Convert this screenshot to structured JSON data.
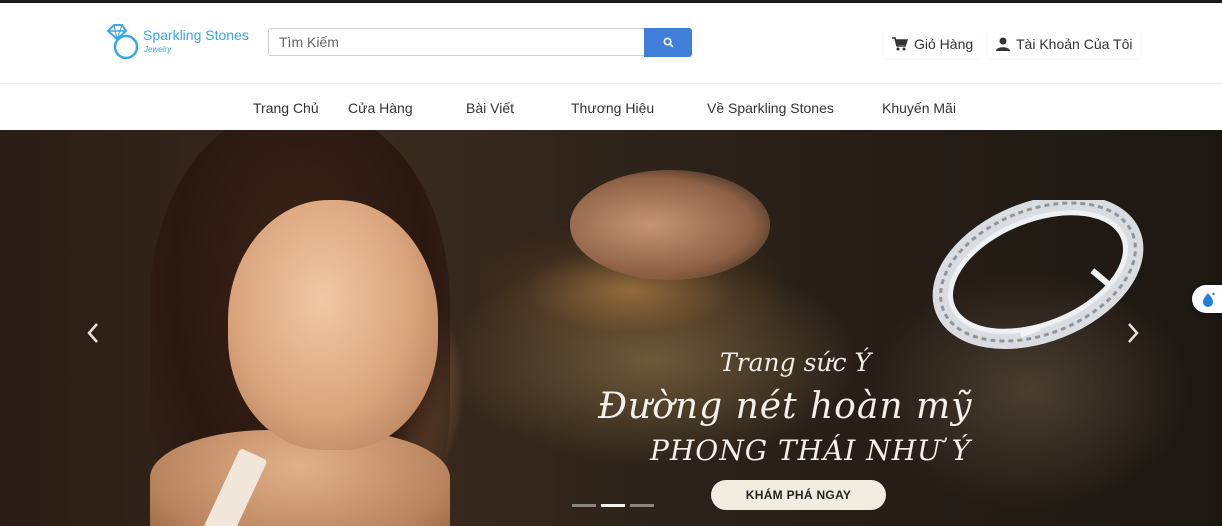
{
  "brand": {
    "name": "Sparkling Stones",
    "tagline": "Jewelry",
    "color": "#3aa6e8"
  },
  "search": {
    "placeholder": "Tìm Kiếm",
    "value": "",
    "button_color": "#3f7fd9"
  },
  "header": {
    "cart_label": "Giỏ Hàng",
    "account_label": "Tài Khoản Của Tôi"
  },
  "nav": {
    "items": [
      {
        "label": "Trang Chủ"
      },
      {
        "label": "Cửa Hàng"
      },
      {
        "label": "Bài Viết"
      },
      {
        "label": "Thương Hiệu"
      },
      {
        "label": "Về Sparkling Stones"
      },
      {
        "label": "Khuyến Mãi"
      }
    ]
  },
  "hero": {
    "line1": "Trang sức Ý",
    "line2": "Đường nét hoàn mỹ",
    "line3": "PHONG THÁI NHƯ Ý",
    "cta_label": "KHÁM PHÁ NGAY",
    "slides_total": 3,
    "active_slide": 2
  },
  "icons": {
    "search": "search-icon",
    "cart": "cart-icon",
    "account": "user-icon",
    "prev": "chevron-left-icon",
    "next": "chevron-right-icon",
    "widget": "water-drop-icon"
  }
}
